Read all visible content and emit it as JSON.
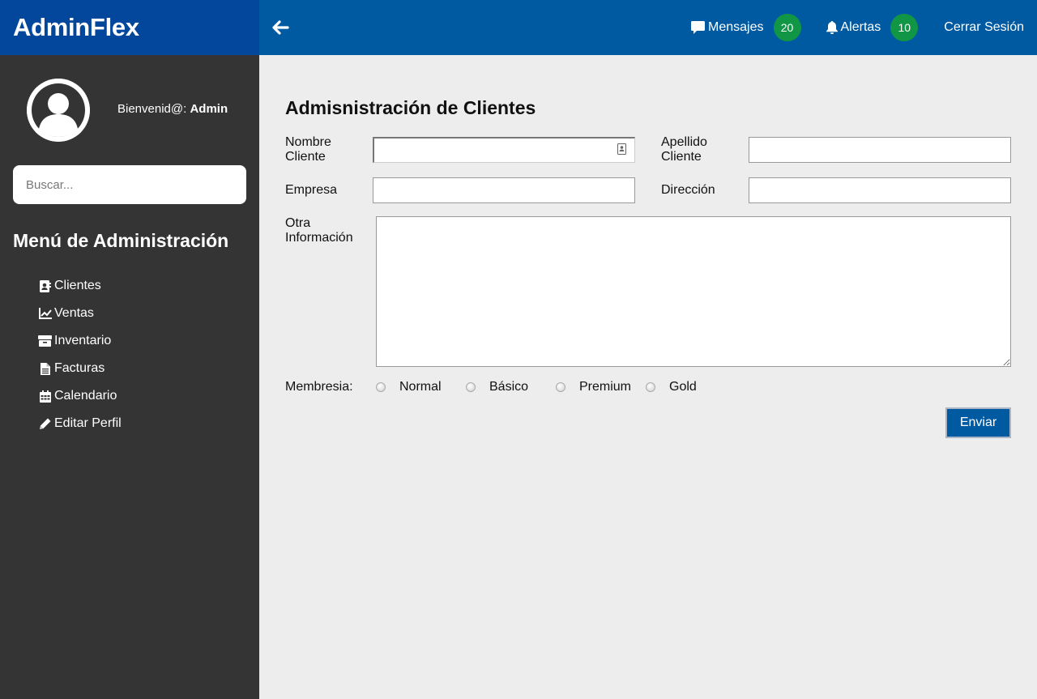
{
  "brand": {
    "name": "AdminFlex"
  },
  "profile": {
    "greeting": "Bienvenid@:",
    "user": "Admin"
  },
  "search": {
    "placeholder": "Buscar..."
  },
  "menu": {
    "title": "Menú de Administración",
    "items": [
      {
        "label": "Clientes",
        "icon": "address-book-icon"
      },
      {
        "label": "Ventas",
        "icon": "chart-line-icon"
      },
      {
        "label": "Inventario",
        "icon": "box-icon"
      },
      {
        "label": "Facturas",
        "icon": "file-icon"
      },
      {
        "label": "Calendario",
        "icon": "calendar-icon"
      },
      {
        "label": "Editar Perfil",
        "icon": "pencil-icon"
      }
    ]
  },
  "topbar": {
    "messages_label": "Mensajes",
    "messages_count": "20",
    "alerts_label": "Alertas",
    "alerts_count": "10",
    "logout_label": "Cerrar Sesión"
  },
  "form": {
    "title": "Admisnistración de Clientes",
    "nombre_label_1": "Nombre",
    "nombre_label_2": "Cliente",
    "nombre_value": "",
    "apellido_label_1": "Apellido",
    "apellido_label_2": "Cliente",
    "apellido_value": "",
    "empresa_label": "Empresa",
    "empresa_value": "",
    "direccion_label": "Dirección",
    "direccion_value": "",
    "otra_label_1": "Otra",
    "otra_label_2": "Información",
    "otra_value": "",
    "membresia_label": "Membresia:",
    "membresia_options": [
      "Normal",
      "Básico",
      "Premium",
      "Gold"
    ],
    "submit_label": "Enviar"
  },
  "colors": {
    "brand_bg": "#02479b",
    "topbar_bg": "#005aa2",
    "sidebar_bg": "#343434",
    "badge_bg": "#119645",
    "content_bg": "#ededed"
  }
}
